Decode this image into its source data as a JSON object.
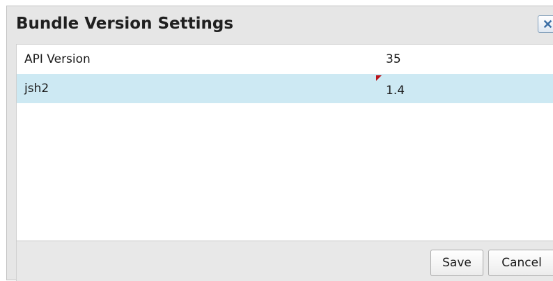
{
  "dialog": {
    "title": "Bundle Version Settings",
    "close_label": "✕"
  },
  "grid": {
    "rows": [
      {
        "name": "API Version",
        "value": "35",
        "modified": false,
        "selected": false
      },
      {
        "name": "jsh2",
        "value": "1.4",
        "modified": true,
        "selected": true
      }
    ]
  },
  "footer": {
    "save_label": "Save",
    "cancel_label": "Cancel"
  },
  "colors": {
    "selected_row": "#cde9f3",
    "modified_marker": "#b8141b",
    "dialog_bg": "#e6e6e6"
  },
  "icons": {
    "close": "close-icon"
  }
}
